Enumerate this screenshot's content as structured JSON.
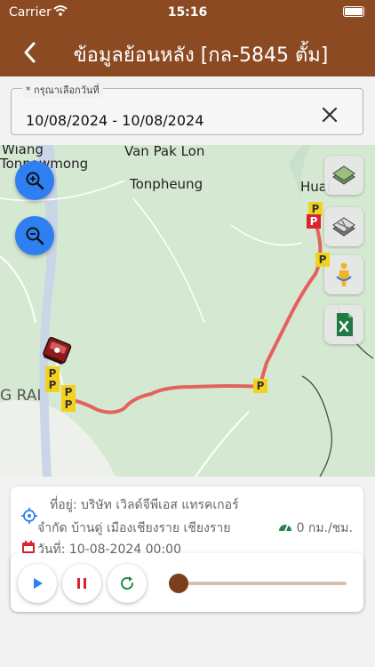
{
  "status_bar": {
    "carrier": "Carrier",
    "time": "15:16"
  },
  "header": {
    "title": "ข้อมูลย้อนหลัง [กล-5845 ตั้ม]"
  },
  "date_picker": {
    "label": "* กรุณาเลือกวันที่",
    "value": "10/08/2024 - 10/08/2024"
  },
  "map": {
    "labels": [
      "Van Pak Lon",
      "Tonpheung",
      "Wiang",
      "Tonpawmong",
      "Huai",
      "G RAI"
    ],
    "route_color": "#e4625e",
    "parking_label": "P"
  },
  "info": {
    "address_line1": "ที่อยู่: บริษัท เวิลด์จีพีเอส แทรคเกอร์",
    "address_line2": "จำกัด บ้านดู่ เมืองเชียงราย เชียงราย",
    "date_line": "วันที่: 10-08-2024 00:00",
    "speed": "0 กม./ชม."
  },
  "playback": {
    "progress_fraction": 0.02
  },
  "colors": {
    "brand": "#8b4a22",
    "zoom_button": "#2d7ff2",
    "slider_thumb": "#7b3f1a"
  }
}
